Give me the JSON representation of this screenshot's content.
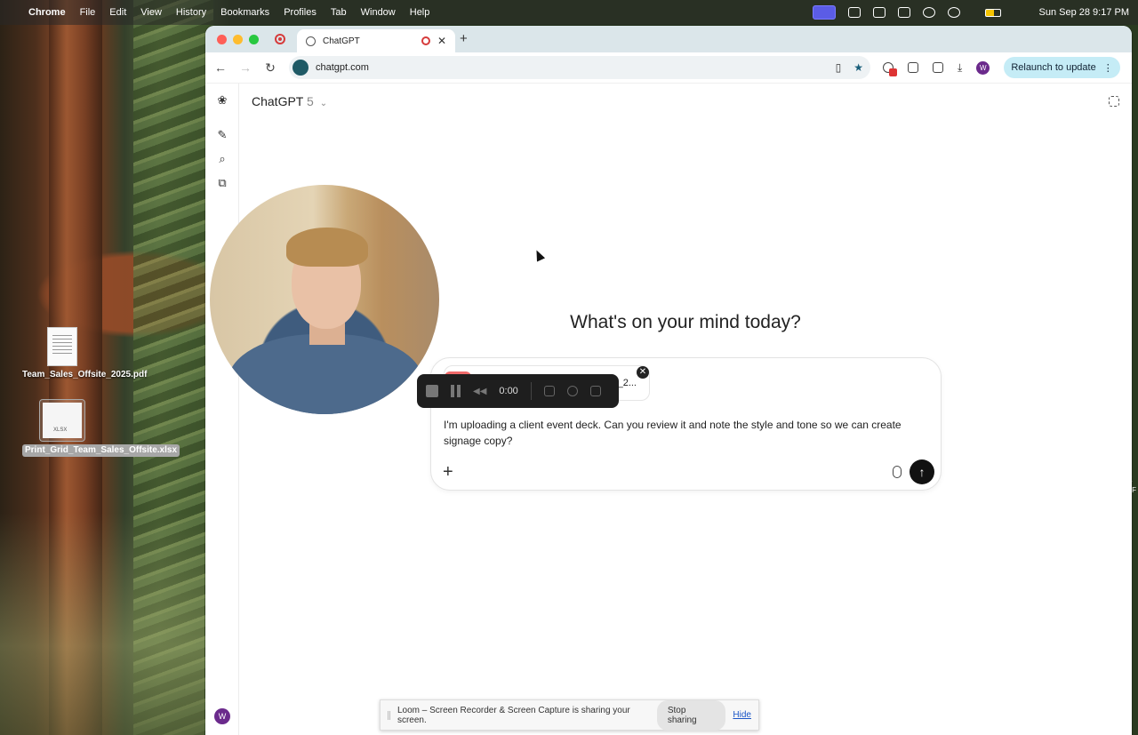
{
  "menubar": {
    "app": "Chrome",
    "items": [
      "File",
      "Edit",
      "View",
      "History",
      "Bookmarks",
      "Profiles",
      "Tab",
      "Window",
      "Help"
    ],
    "datetime": "Sun Sep 28  9:17 PM"
  },
  "desktop": {
    "files": [
      {
        "name": "Team_Sales_Offsite_2025.pdf",
        "icon": "pdf-file-icon"
      },
      {
        "name": "Print_Grid_Team_Sales_Offsite.xlsx",
        "icon": "xlsx-file-icon"
      }
    ],
    "edge_text": "K\nt-F"
  },
  "browser": {
    "tab_title": "ChatGPT",
    "url": "chatgpt.com",
    "profile_initial": "W",
    "relaunch_label": "Relaunch to update"
  },
  "chatgpt": {
    "model_name": "ChatGPT",
    "model_version": "5",
    "heading": "What's on your mind today?",
    "attachment_name": "e_2...",
    "prompt": "I'm uploading a client event deck. Can you review it and note the style and tone so we can create signage copy?",
    "user_initial": "W"
  },
  "loom": {
    "timer": "0:00",
    "share_message": "Loom – Screen Recorder & Screen Capture is sharing your screen.",
    "stop_label": "Stop sharing",
    "hide_label": "Hide"
  },
  "colors": {
    "accent_send": "#111111",
    "relaunch_bg": "#c5ecf6",
    "avatar": "#6b2a8c",
    "recording": "#d63b3b"
  }
}
